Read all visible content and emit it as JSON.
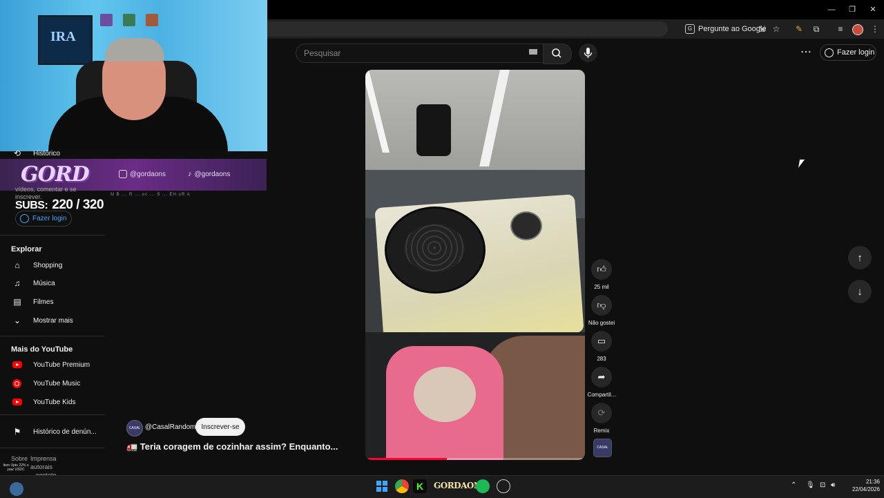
{
  "browser": {
    "ask_google": "Pergunte ao Google"
  },
  "header": {
    "search_placeholder": "Pesquisar",
    "login_label": "Fazer login"
  },
  "stream_overlay": {
    "banner_logo": "GORD",
    "instagram_handle": "@gordaons",
    "tiktok_handle": "@gordaons",
    "ticker": "M B ... R ... oc ... S ... EH oR A",
    "subs_label": "SUBS:",
    "subs_value": "220 / 320"
  },
  "sidebar": {
    "history": "Histórico",
    "signin_text": "vídeos, comentar e se inscrever.",
    "login_label": "Fazer login",
    "explore_heading": "Explorar",
    "explore_items": [
      {
        "label": "Shopping",
        "icon": "shopping-bag-icon"
      },
      {
        "label": "Música",
        "icon": "music-note-icon"
      },
      {
        "label": "Filmes",
        "icon": "film-icon"
      },
      {
        "label": "Mostrar mais",
        "icon": "chevron-down-icon"
      }
    ],
    "more_heading": "Mais do YouTube",
    "more_items": [
      {
        "label": "YouTube Premium"
      },
      {
        "label": "YouTube Music"
      },
      {
        "label": "YouTube Kids"
      }
    ],
    "report_history": "Histórico de denún...",
    "footer": [
      "Sobre",
      "Imprensa",
      "autorais",
      "contato"
    ]
  },
  "short": {
    "progress": 0.37,
    "channel_avatar_text": "CASAL",
    "channel": "@CasalRandom",
    "subscribe_label": "Inscrever-se",
    "title": "🚛 Teria coragem de cozinhar assim? Enquanto..."
  },
  "actions": {
    "like_count": "25 mil",
    "dislike_label": "Não gostei",
    "comment_count": "283",
    "share_label": "Compartil...",
    "remix_label": "Remix"
  },
  "taskbar": {
    "gordaons_label": "GORDAONS",
    "time": "21:36",
    "date": "22/04/2026",
    "weather": "Item Upto 22% o yaur USDC"
  },
  "colors": {
    "youtube_red": "#ff0000",
    "link_blue": "#3ea6ff",
    "background": "#0f0f0f"
  }
}
